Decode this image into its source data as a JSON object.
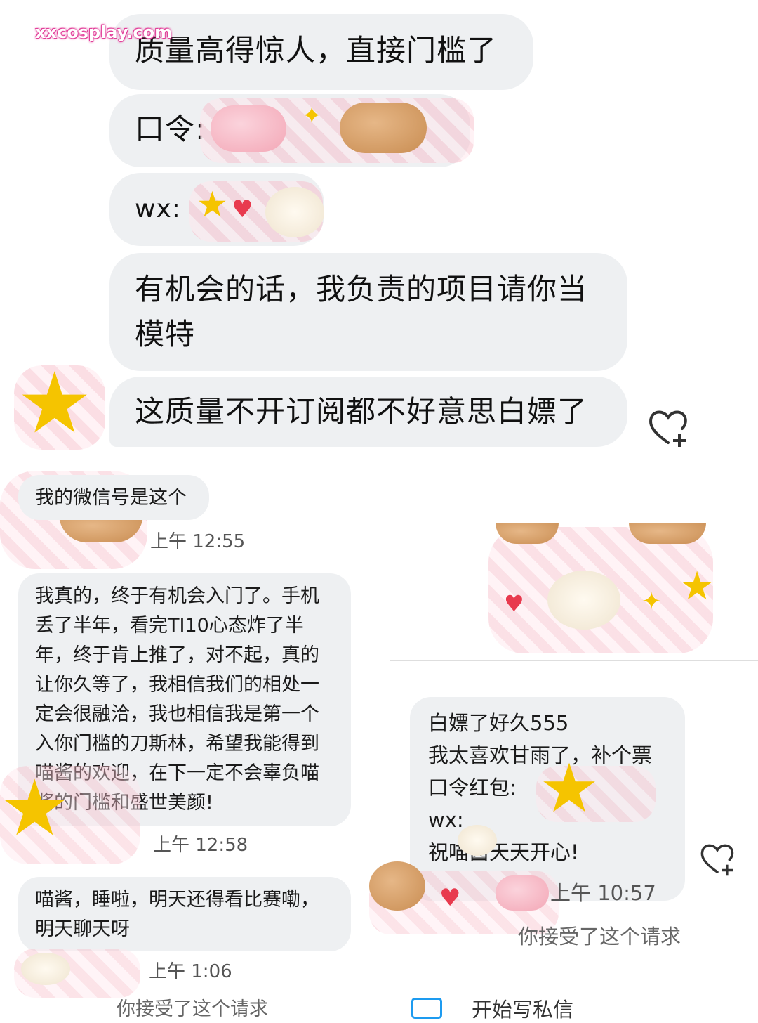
{
  "watermark": "xxcosplay.com",
  "top_thread": {
    "messages": [
      {
        "text": "质量高得惊人，直接门槛了"
      },
      {
        "text": "口令:"
      },
      {
        "text": "wx:"
      },
      {
        "text_line1": "有机会的话，我负责的项目请你当",
        "text_line2": "模特"
      },
      {
        "text": "这质量不开订阅都不好意思白嫖了"
      }
    ]
  },
  "left_thread": {
    "messages": [
      {
        "text": "我的微信号是这个",
        "time": "上午 12:55"
      },
      {
        "lines": [
          "我真的，终于有机会入门了。手机",
          "丢了半年，看完TI10心态炸了半",
          "年，终于肯上推了，对不起，真的",
          "让你久等了，我相信我们的相处一",
          "定会很融洽，我也相信我是第一个",
          "入你门槛的刀斯林，希望我能得到",
          "喵酱的欢迎，在下一定不会辜负喵",
          "酱的门槛和盛世美颜!"
        ],
        "time": "上午 12:58"
      },
      {
        "lines": [
          "喵酱，睡啦，明天还得看比赛嘞，",
          "明天聊天呀"
        ],
        "time": "上午 1:06"
      }
    ],
    "system": "你接受了这个请求"
  },
  "right_thread": {
    "message_lines": [
      "白嫖了好久555",
      "我太喜欢甘雨了，补个票",
      "口令红包:",
      "wx:",
      "祝喵酱天天开心!"
    ],
    "time": "上午 10:57",
    "system": "你接受了这个请求",
    "compose_label": "开始写私信"
  },
  "colors": {
    "bubble": "#eef0f2",
    "watermark_pink": "#e2409a"
  }
}
